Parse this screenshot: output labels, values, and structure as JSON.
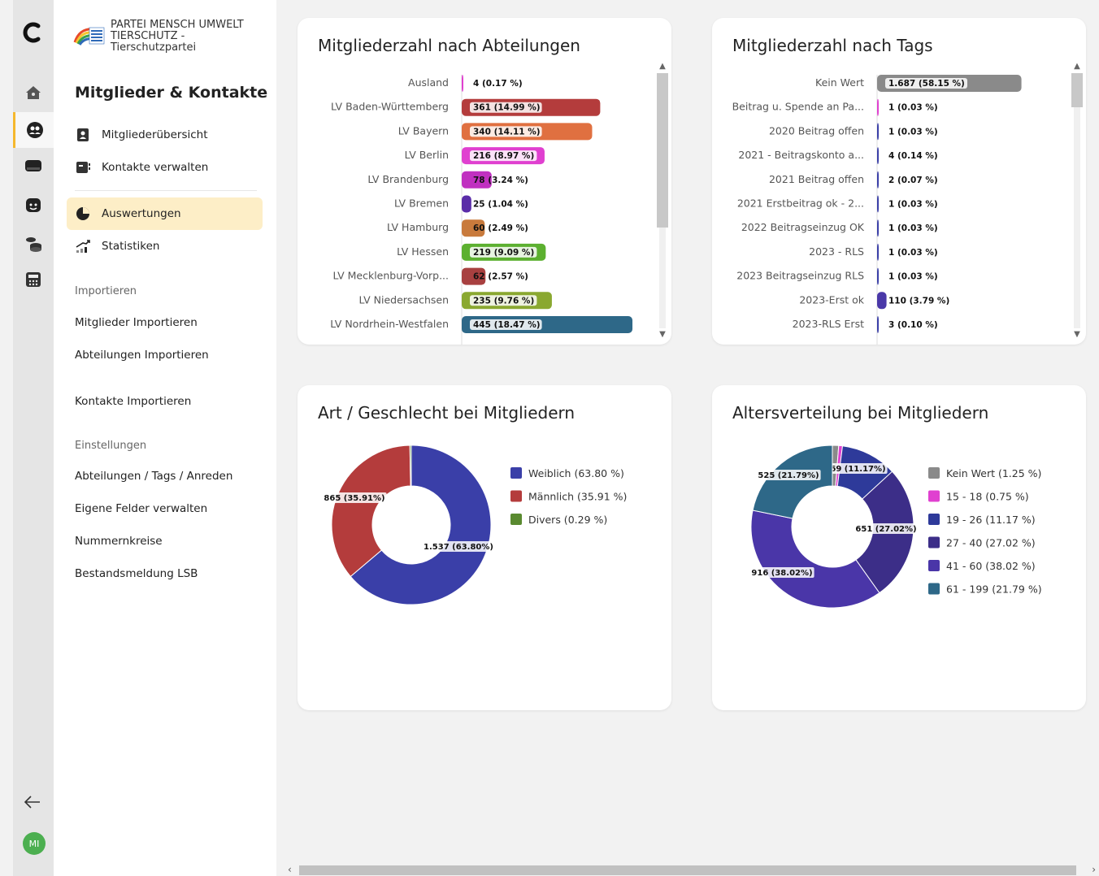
{
  "organization": {
    "name_line1": "PARTEI MENSCH UMWELT",
    "name_line2": "TIERSCHUTZ -",
    "name_line3": "Tierschutzpartei"
  },
  "nav": {
    "title": "Mitglieder & Kontakte",
    "links": [
      {
        "label": "Mitgliederübersicht",
        "icon": "member-card-icon"
      },
      {
        "label": "Kontakte verwalten",
        "icon": "contact-card-icon"
      },
      {
        "label": "Auswertungen",
        "icon": "pie-chart-icon",
        "active": true
      },
      {
        "label": "Statistiken",
        "icon": "trend-chart-icon"
      }
    ],
    "import_heading": "Importieren",
    "import_links": [
      "Mitglieder Importieren",
      "Abteilungen Importieren",
      "Kontakte Importieren"
    ],
    "settings_heading": "Einstellungen",
    "settings_links": [
      "Abteilungen / Tags / Anreden",
      "Eigene Felder verwalten",
      "Nummernkreise",
      "Bestandsmeldung LSB"
    ]
  },
  "rail": {
    "avatar_initials": "MI",
    "active_index": 1
  },
  "chart_data": [
    {
      "type": "bar",
      "orientation": "horizontal",
      "title": "Mitgliederzahl nach Abteilungen",
      "categories": [
        "Ausland",
        "LV Baden-Württemberg",
        "LV Bayern",
        "LV Berlin",
        "LV Brandenburg",
        "LV Bremen",
        "LV Hamburg",
        "LV Hessen",
        "LV Mecklenburg-Vorp...",
        "LV Niedersachsen",
        "LV Nordrhein-Westfalen"
      ],
      "values": [
        4,
        361,
        340,
        216,
        78,
        25,
        60,
        219,
        62,
        235,
        445
      ],
      "labels": [
        "4 (0.17 %)",
        "361 (14.99 %)",
        "340 (14.11 %)",
        "216 (8.97 %)",
        "78 (3.24 %)",
        "25 (1.04 %)",
        "60 (2.49 %)",
        "219 (9.09 %)",
        "62 (2.57 %)",
        "235 (9.76 %)",
        "445 (18.47 %)"
      ],
      "colors": [
        "#e040d0",
        "#b43c3c",
        "#e07040",
        "#e040d0",
        "#c030c0",
        "#5a2ca8",
        "#c87a3c",
        "#5cb030",
        "#a84040",
        "#8aa830",
        "#2e6888"
      ],
      "xlim": [
        0,
        500
      ]
    },
    {
      "type": "bar",
      "orientation": "horizontal",
      "title": "Mitgliederzahl nach Tags",
      "categories": [
        "Kein Wert",
        "Beitrag u. Spende an Pa...",
        "2020 Beitrag offen",
        "2021 - Beitragskonto a...",
        "2021 Beitrag offen",
        "2021 Erstbeitrag ok - 2...",
        "2022 Beitragseinzug OK",
        "2023 - RLS",
        "2023 Beitragseinzug RLS",
        "2023-Erst ok",
        "2023-RLS Erst"
      ],
      "values": [
        1687,
        1,
        1,
        4,
        2,
        1,
        1,
        1,
        1,
        110,
        3
      ],
      "labels": [
        "1.687 (58.15 %)",
        "1 (0.03 %)",
        "1 (0.03 %)",
        "4 (0.14 %)",
        "2 (0.07 %)",
        "1 (0.03 %)",
        "1 (0.03 %)",
        "1 (0.03 %)",
        "1 (0.03 %)",
        "110 (3.79 %)",
        "3 (0.10 %)"
      ],
      "colors": [
        "#8a8a8a",
        "#e040d0",
        "#3a3fa8",
        "#3a3fa8",
        "#3a3fa8",
        "#3a3fa8",
        "#3a3fa8",
        "#3a3fa8",
        "#3a3fa8",
        "#4a38a8",
        "#3a3fa8"
      ],
      "xlim": [
        0,
        1900
      ]
    },
    {
      "type": "pie",
      "title": "Art / Geschlecht bei Mitgliedern",
      "slices": [
        {
          "name": "Weiblich (63.80 %)",
          "value": 1537,
          "label": "1.537 (63.80%)",
          "color": "#3a3fa8"
        },
        {
          "name": "Männlich (35.91 %)",
          "value": 865,
          "label": "865 (35.91%)",
          "color": "#b43c3c"
        },
        {
          "name": "Divers (0.29 %)",
          "value": 7,
          "label": "",
          "color": "#5a8a30"
        }
      ]
    },
    {
      "type": "pie",
      "title": "Altersverteilung bei Mitgliedern",
      "slices": [
        {
          "name": "Kein Wert (1.25 %)",
          "value": 30,
          "label": "",
          "color": "#8a8a8a"
        },
        {
          "name": "15 - 18 (0.75 %)",
          "value": 18,
          "label": "",
          "color": "#e040d0"
        },
        {
          "name": "19 - 26 (11.17 %)",
          "value": 269,
          "label": "269 (11.17%)",
          "color": "#2e3a9a"
        },
        {
          "name": "27 - 40 (27.02 %)",
          "value": 651,
          "label": "651 (27.02%)",
          "color": "#3c2e88"
        },
        {
          "name": "41 - 60 (38.02 %)",
          "value": 916,
          "label": "916 (38.02%)",
          "color": "#4a36a8"
        },
        {
          "name": "61 - 199 (21.79 %)",
          "value": 525,
          "label": "525 (21.79%)",
          "color": "#2e6888"
        }
      ]
    }
  ]
}
